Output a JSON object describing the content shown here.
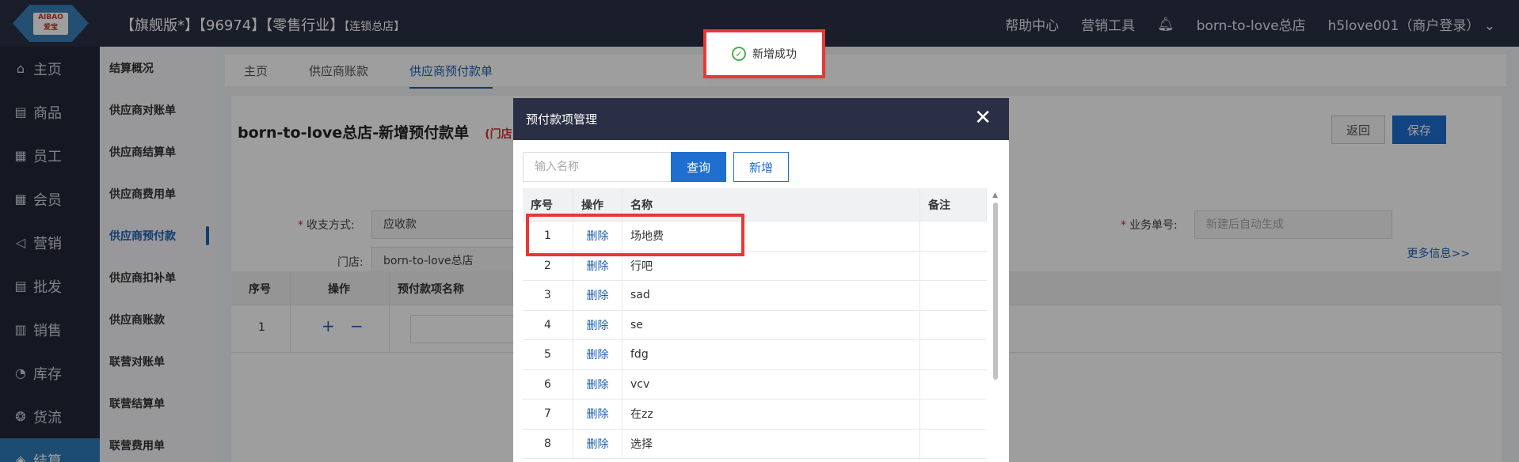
{
  "header": {
    "logo_text_top": "AIBAO",
    "logo_text_bottom": "爱宝",
    "store_title": "【旗舰版*】【96974】【零售行业】",
    "store_subtitle": "【连锁总店】",
    "help": "帮助中心",
    "marketing_tools": "营销工具",
    "store_name": "born-to-love总店",
    "user": "h5love001（商户登录）"
  },
  "leftnav": [
    {
      "icon": "home-icon",
      "glyph": "⌂",
      "label": "主页"
    },
    {
      "icon": "goods-icon",
      "glyph": "▤",
      "label": "商品"
    },
    {
      "icon": "staff-icon",
      "glyph": "▦",
      "label": "员工"
    },
    {
      "icon": "member-icon",
      "glyph": "▦",
      "label": "会员"
    },
    {
      "icon": "marketing-icon",
      "glyph": "◁",
      "label": "营销"
    },
    {
      "icon": "wholesale-icon",
      "glyph": "▤",
      "label": "批发"
    },
    {
      "icon": "sales-icon",
      "glyph": "▥",
      "label": "销售"
    },
    {
      "icon": "stock-icon",
      "glyph": "◔",
      "label": "库存"
    },
    {
      "icon": "logistics-icon",
      "glyph": "❂",
      "label": "货流"
    },
    {
      "icon": "settlement-icon",
      "glyph": "◈",
      "label": "结算"
    }
  ],
  "subnav": [
    "结算概况",
    "供应商对账单",
    "供应商结算单",
    "供应商费用单",
    "供应商预付款",
    "供应商扣补单",
    "供应商账款",
    "联营对账单",
    "联营结算单",
    "联营费用单"
  ],
  "tabs": [
    "主页",
    "供应商账款",
    "供应商预付款单"
  ],
  "form": {
    "title": "born-to-love总店-新增预付款单",
    "title_tag": "(门店",
    "back": "返回",
    "save": "保存",
    "pay_method_label": "收支方式:",
    "pay_method_value": "应收款",
    "store_label": "门店:",
    "store_value": "born-to-love总店",
    "biz_no_label": "业务单号:",
    "biz_no_placeholder": "新建后自动生成",
    "more_info": "更多信息>>",
    "grid_headers": [
      "序号",
      "操作",
      "预付款项名称"
    ],
    "grid_row_no": "1",
    "grid_plus": "+",
    "grid_minus": "−"
  },
  "toast": {
    "text": "新增成功"
  },
  "modal": {
    "title": "预付款项管理",
    "close": "✕",
    "search_placeholder": "输入名称",
    "query": "查询",
    "add": "新增",
    "headers": [
      "序号",
      "操作",
      "名称",
      "备注"
    ],
    "rows": [
      {
        "no": "1",
        "op": "删除",
        "name": "场地费",
        "note": ""
      },
      {
        "no": "2",
        "op": "删除",
        "name": "行吧",
        "note": ""
      },
      {
        "no": "3",
        "op": "删除",
        "name": "sad",
        "note": ""
      },
      {
        "no": "4",
        "op": "删除",
        "name": "se",
        "note": ""
      },
      {
        "no": "5",
        "op": "删除",
        "name": "fdg",
        "note": ""
      },
      {
        "no": "6",
        "op": "删除",
        "name": "vcv",
        "note": ""
      },
      {
        "no": "7",
        "op": "删除",
        "name": "在zz",
        "note": ""
      },
      {
        "no": "8",
        "op": "删除",
        "name": "选择",
        "note": ""
      }
    ]
  }
}
